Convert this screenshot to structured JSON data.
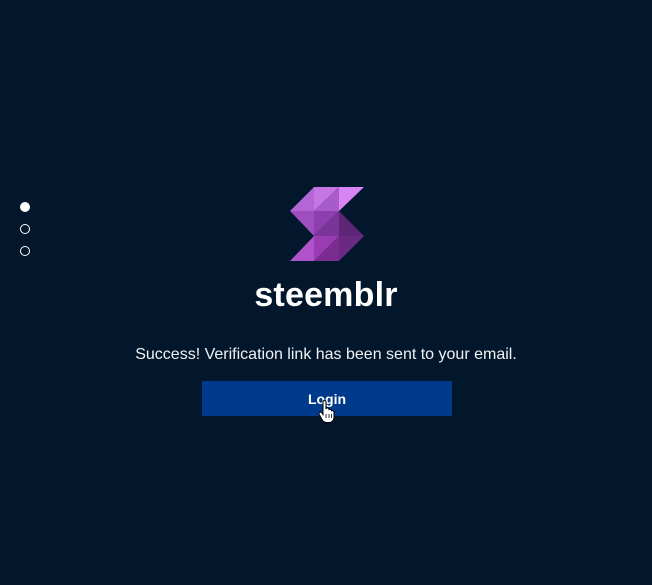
{
  "pager": {
    "dots": [
      {
        "active": true
      },
      {
        "active": false
      },
      {
        "active": false
      }
    ]
  },
  "brand": {
    "name": "steemblr",
    "logo_icon": "steemblr-logo-icon",
    "logo_colors": [
      "#c86ee6",
      "#a95cc9",
      "#8e3fa9",
      "#6f2e86",
      "#5a2470"
    ]
  },
  "message": {
    "text": "Success! Verification link has been sent to your email."
  },
  "actions": {
    "login_label": "Login"
  },
  "cursor": {
    "icon": "hand-pointer-icon"
  },
  "colors": {
    "background": "#03172c",
    "button": "#003a8c",
    "text": "#ffffff"
  }
}
